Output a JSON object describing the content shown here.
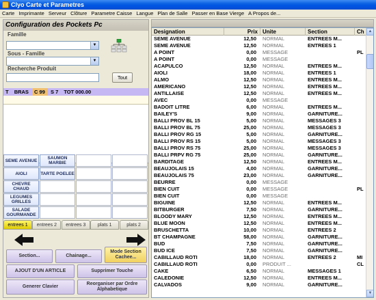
{
  "window": {
    "title": "Clyo Carte et Parametres"
  },
  "menu": [
    "Carte",
    "Imprimante",
    "Serveur",
    "Clôture",
    "Parametre Caisse",
    "Langue",
    "Plan de Salle",
    "Passer en Base Vierge",
    "A Propos de..."
  ],
  "left": {
    "header": "Configuration des Pockets Pc",
    "famille_label": "Famille",
    "sous_famille_label": "Sous - Famille",
    "recherche_label": "Recherche Produit",
    "tout_button": "Tout",
    "status": {
      "t": "T",
      "bras": "BRAS",
      "c": "C 99",
      "s": "S 7",
      "tot": "TOT 000.00"
    },
    "quick_products": [
      {
        "label": "SEME AVENUE"
      },
      {
        "label": "SAUMON MARBIE"
      },
      {
        "label": "AIOLI"
      },
      {
        "label": "TARTE POELEE"
      },
      {
        "label": "CHEVRE CHAUD"
      },
      {
        "label": "LEGUMES GRILLES"
      },
      {
        "label": "SALADE GOURMANDE"
      }
    ],
    "tabs": [
      {
        "label": "entrees 1",
        "active": true
      },
      {
        "label": "entrees 2",
        "active": false
      },
      {
        "label": "entrees 3",
        "active": false
      },
      {
        "label": "plats 1",
        "active": false
      },
      {
        "label": "plats 2",
        "active": false
      }
    ],
    "buttons": {
      "section": "Section...",
      "chainage": "Chainage...",
      "mode_section": "Mode Section Cachee...",
      "ajout": "AJOUT D'UN ARTICLE",
      "supprimer": "Supprimer Touche",
      "generer": "Generer Clavier",
      "reorganiser": "Reorganiser par Ordre Alphabetique"
    }
  },
  "table": {
    "columns": [
      "Designation",
      "Prix",
      "Unite",
      "Section",
      "Ch"
    ],
    "rows": [
      [
        "SEME AVENUE",
        "12,50",
        "NORMAL",
        "ENTREES M...",
        ""
      ],
      [
        "SEME AVENUE",
        "12,50",
        "NORMAL",
        "ENTREES 1",
        ""
      ],
      [
        "A POINT",
        "0,00",
        "MESSAGE",
        "",
        "PL"
      ],
      [
        "A POINT",
        "0,00",
        "MESSAGE",
        "",
        ""
      ],
      [
        "ACAPULCO",
        "12,50",
        "NORMAL",
        "ENTREES M...",
        ""
      ],
      [
        "AIOLI",
        "18,00",
        "NORMAL",
        "ENTREES 1",
        ""
      ],
      [
        "ALMO",
        "12,50",
        "NORMAL",
        "ENTREES M...",
        ""
      ],
      [
        "AMERICANO",
        "12,50",
        "NORMAL",
        "ENTREES M...",
        ""
      ],
      [
        "ANTILLAISE",
        "12,50",
        "NORMAL",
        "ENTREES M...",
        ""
      ],
      [
        "AVEC",
        "0,00",
        "MESSAGE",
        "",
        ""
      ],
      [
        "BADOIT LITRE",
        "6,00",
        "NORMAL",
        "ENTREES M...",
        ""
      ],
      [
        "BAILEY'S",
        "9,00",
        "NORMAL",
        "GARNITURE...",
        ""
      ],
      [
        "BALLI PROV BL 15",
        "5,00",
        "NORMAL",
        "MESSAGES 3",
        ""
      ],
      [
        "BALLI PROV BL 75",
        "25,00",
        "NORMAL",
        "MESSAGES 3",
        ""
      ],
      [
        "BALLI PROV RG 15",
        "5,00",
        "NORMAL",
        "GARNITURE...",
        ""
      ],
      [
        "BALLI PROV RS 15",
        "5,00",
        "NORMAL",
        "MESSAGES 3",
        ""
      ],
      [
        "BALLI PROV RS 75",
        "25,00",
        "NORMAL",
        "MESSAGES 3",
        ""
      ],
      [
        "BALLI PRPV RG 75",
        "25,00",
        "NORMAL",
        "GARNITURE...",
        ""
      ],
      [
        "BARDITAGE",
        "12,50",
        "NORMAL",
        "ENTREES M...",
        ""
      ],
      [
        "BEAUJOLAIS 15",
        "4,00",
        "NORMAL",
        "GARNITURE...",
        ""
      ],
      [
        "BEAUJOLAIS 75",
        "23,00",
        "NORMAL",
        "GARNITURE...",
        ""
      ],
      [
        "BEURRE",
        "0,00",
        "MESSAGE",
        "",
        ""
      ],
      [
        "BIEN CUIT",
        "0,00",
        "MESSAGE",
        "",
        "PL"
      ],
      [
        "BIEN CUIT",
        "0,00",
        "MESSAGE",
        "",
        ""
      ],
      [
        "BIGUINE",
        "12,50",
        "NORMAL",
        "ENTREES M...",
        ""
      ],
      [
        "BITBURGER",
        "7,50",
        "NORMAL",
        "GARNITURE...",
        ""
      ],
      [
        "BLOODY MARY",
        "12,50",
        "NORMAL",
        "ENTREES M...",
        ""
      ],
      [
        "BLUE MOON",
        "12,50",
        "NORMAL",
        "ENTREES M...",
        ""
      ],
      [
        "BRUSCHETTA",
        "10,00",
        "NORMAL",
        "ENTREES 2",
        ""
      ],
      [
        "BT CHAMPAGNE",
        "58,00",
        "NORMAL",
        "GARNITURE...",
        ""
      ],
      [
        "BUD",
        "7,50",
        "NORMAL",
        "GARNITURE...",
        ""
      ],
      [
        "BUD ICE",
        "7,50",
        "NORMAL",
        "GARNITURE...",
        ""
      ],
      [
        "CABILLAUD ROTI",
        "18,00",
        "NORMAL",
        "ENTREES 2",
        "MI"
      ],
      [
        "CABILLAUD ROTI",
        "0,00",
        "PRODUIT ...",
        "",
        "CL"
      ],
      [
        "CAKE",
        "6,50",
        "NORMAL",
        "MESSAGES 1",
        ""
      ],
      [
        "CALEDONIE",
        "12,50",
        "NORMAL",
        "ENTREES M...",
        ""
      ],
      [
        "CALVADOS",
        "9,00",
        "NORMAL",
        "GARNITURE...",
        ""
      ]
    ]
  }
}
